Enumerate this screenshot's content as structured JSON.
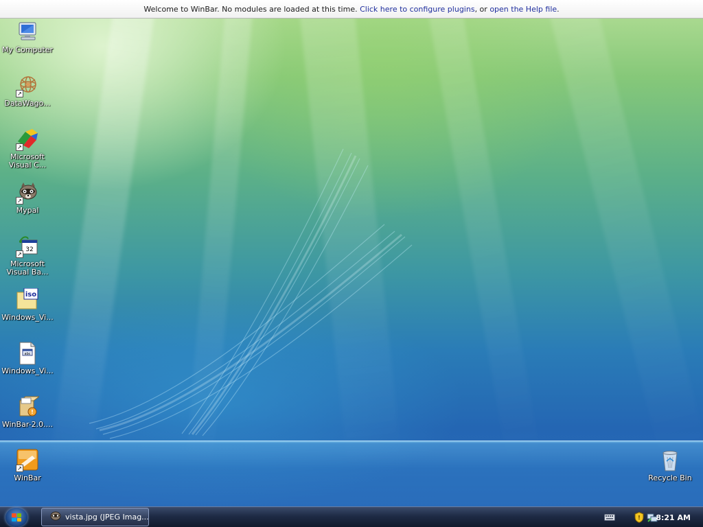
{
  "winbar": {
    "message": "Welcome to WinBar. No modules are loaded at this time.",
    "link_configure": "Click here to configure plugins",
    "separator": ", or",
    "link_help": "open the Help file",
    "end": "."
  },
  "desktop_icons": [
    {
      "label": "My Computer",
      "icon": "computer-icon"
    },
    {
      "label": "DataWago...",
      "icon": "datawagon-icon"
    },
    {
      "label": "Microsoft Visual C...",
      "icon": "visual-cpp-icon"
    },
    {
      "label": "Mypal",
      "icon": "mypal-icon"
    },
    {
      "label": "Microsoft Visual Ba...",
      "icon": "visual-basic-icon"
    },
    {
      "label": "Windows_Vi...",
      "icon": "iso-file-icon"
    },
    {
      "label": "Windows_Vi...",
      "icon": "text-file-icon"
    },
    {
      "label": "WinBar-2.0....",
      "icon": "installer-icon"
    },
    {
      "label": "WinBar",
      "icon": "winbar-icon"
    }
  ],
  "recycle_bin": {
    "label": "Recycle Bin",
    "icon": "recycle-bin-icon"
  },
  "taskbar": {
    "task_label": "vista.jpg (JPEG Imag...",
    "task_icon": "image-viewer-icon",
    "clock": "8:21 AM"
  },
  "colors": {
    "link": "#1f2e9e",
    "taskbar": "#1e2b45"
  }
}
